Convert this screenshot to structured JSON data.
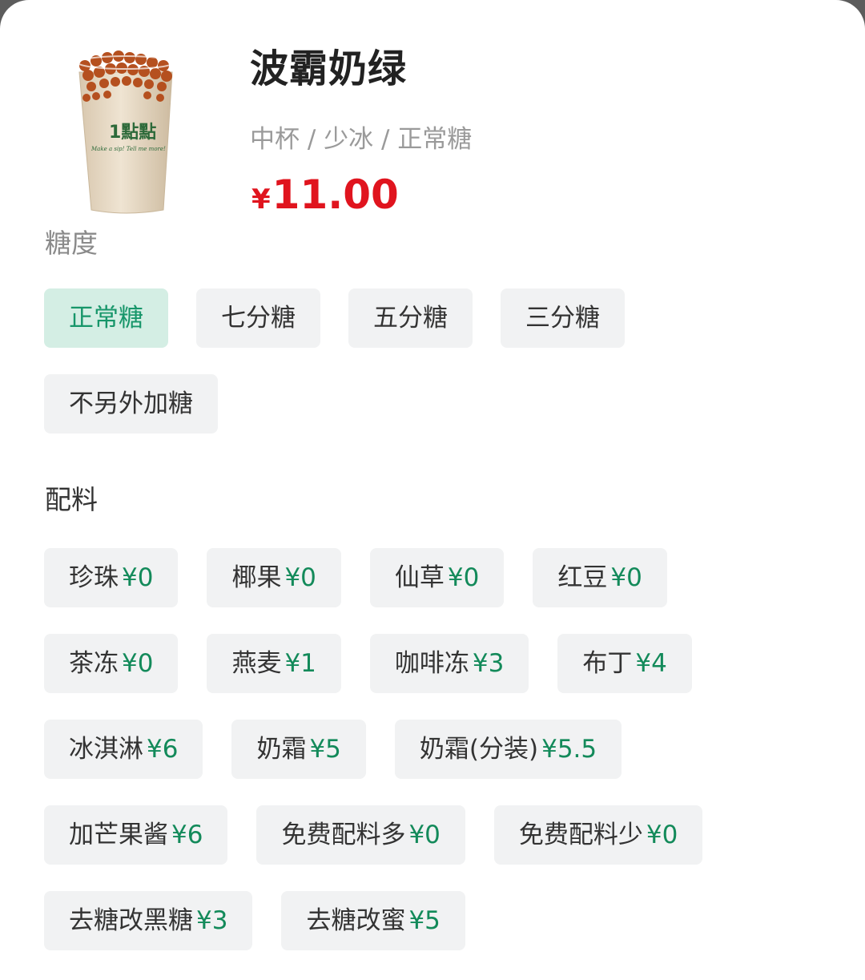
{
  "product": {
    "name": "波霸奶绿",
    "spec": "中杯 / 少冰 / 正常糖",
    "price_symbol": "¥",
    "price": "11.00",
    "cup_brand": "1點點",
    "cup_slogan": "Make a sip! Tell me more!"
  },
  "sections": {
    "sugar_title": "糖度",
    "toppings_title": "配料"
  },
  "colors": {
    "price_red": "#e0141e",
    "accent_green": "#17966a",
    "selected_bg": "#d4eee4",
    "chip_bg": "#f1f2f3"
  },
  "sugar_options": [
    {
      "label": "正常糖",
      "selected": true
    },
    {
      "label": "七分糖",
      "selected": false
    },
    {
      "label": "五分糖",
      "selected": false
    },
    {
      "label": "三分糖",
      "selected": false
    },
    {
      "label": "不另外加糖",
      "selected": false
    }
  ],
  "toppings": [
    {
      "label": "珍珠",
      "price": "¥0"
    },
    {
      "label": "椰果",
      "price": "¥0"
    },
    {
      "label": "仙草",
      "price": "¥0"
    },
    {
      "label": "红豆",
      "price": "¥0"
    },
    {
      "label": "茶冻",
      "price": "¥0"
    },
    {
      "label": "燕麦",
      "price": "¥1"
    },
    {
      "label": "咖啡冻",
      "price": "¥3"
    },
    {
      "label": "布丁",
      "price": "¥4"
    },
    {
      "label": "冰淇淋",
      "price": "¥6"
    },
    {
      "label": "奶霜",
      "price": "¥5"
    },
    {
      "label": "奶霜(分装)",
      "price": "¥5.5"
    },
    {
      "label": "加芒果酱",
      "price": "¥6"
    },
    {
      "label": "免费配料多",
      "price": "¥0"
    },
    {
      "label": "免费配料少",
      "price": "¥0"
    },
    {
      "label": "去糖改黑糖",
      "price": "¥3"
    },
    {
      "label": "去糖改蜜",
      "price": "¥5"
    }
  ]
}
